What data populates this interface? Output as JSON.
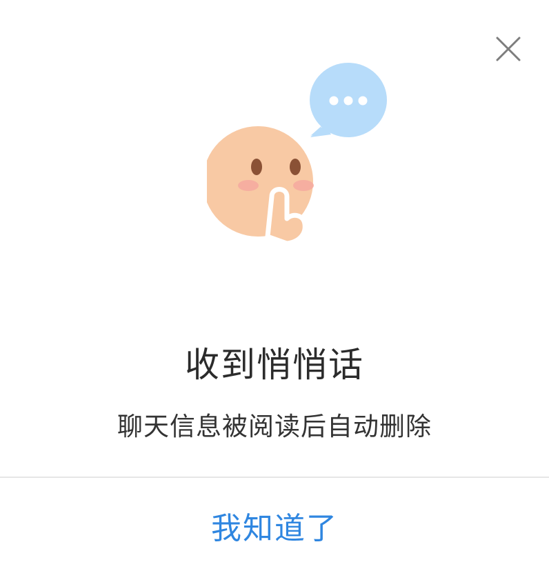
{
  "dialog": {
    "title": "收到悄悄话",
    "subtitle": "聊天信息被阅读后自动删除",
    "confirm_label": "我知道了",
    "close_icon": "close-icon",
    "illustration_icon": "shush-face-icon",
    "colors": {
      "accent": "#2f86e0",
      "face": "#f8c9a4",
      "bubble": "#b7dcfa"
    }
  }
}
